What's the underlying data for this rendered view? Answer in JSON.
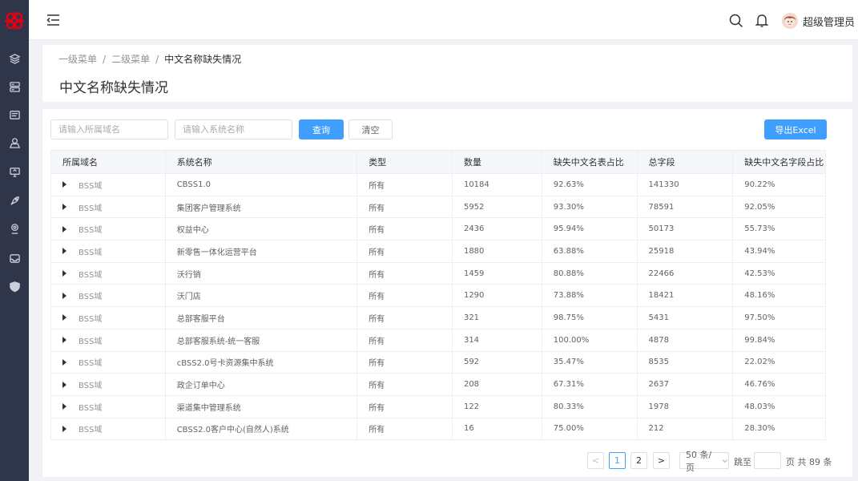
{
  "topbar": {
    "user_name": "超级管理员"
  },
  "breadcrumb": {
    "level1": "一级菜单",
    "level2": "二级菜单",
    "current": "中文名称缺失情况",
    "sep": "/"
  },
  "page": {
    "title": "中文名称缺失情况"
  },
  "filters": {
    "domain_placeholder": "请输入所属域名",
    "system_placeholder": "请输入系统名称",
    "query_label": "查询",
    "clear_label": "清空",
    "export_label": "导出Excel"
  },
  "table": {
    "columns": [
      "所属域名",
      "系统名称",
      "类型",
      "数量",
      "缺失中文名表占比",
      "总字段",
      "缺失中文名字段占比"
    ],
    "rows": [
      [
        "BSS域",
        "CBSS1.0",
        "所有",
        "10184",
        "92.63%",
        "141330",
        "90.22%"
      ],
      [
        "BSS域",
        "集团客户管理系统",
        "所有",
        "5952",
        "93.30%",
        "78591",
        "92.05%"
      ],
      [
        "BSS域",
        "权益中心",
        "所有",
        "2436",
        "95.94%",
        "50173",
        "55.73%"
      ],
      [
        "BSS域",
        "新零售一体化运营平台",
        "所有",
        "1880",
        "63.88%",
        "25918",
        "43.94%"
      ],
      [
        "BSS域",
        "沃行销",
        "所有",
        "1459",
        "80.88%",
        "22466",
        "42.53%"
      ],
      [
        "BSS域",
        "沃门店",
        "所有",
        "1290",
        "73.88%",
        "18421",
        "48.16%"
      ],
      [
        "BSS域",
        "总部客服平台",
        "所有",
        "321",
        "98.75%",
        "5431",
        "97.50%"
      ],
      [
        "BSS域",
        "总部客服系统-统一客服",
        "所有",
        "314",
        "100.00%",
        "4878",
        "99.84%"
      ],
      [
        "BSS域",
        "cBSS2.0号卡资源集中系统",
        "所有",
        "592",
        "35.47%",
        "8535",
        "22.02%"
      ],
      [
        "BSS域",
        "政企订单中心",
        "所有",
        "208",
        "67.31%",
        "2637",
        "46.76%"
      ],
      [
        "BSS域",
        "渠道集中管理系统",
        "所有",
        "122",
        "80.33%",
        "1978",
        "48.03%"
      ],
      [
        "BSS域",
        "CBSS2.0客户中心(自然人)系统",
        "所有",
        "16",
        "75.00%",
        "212",
        "28.30%"
      ]
    ]
  },
  "pagination": {
    "prev": "<",
    "next": ">",
    "pages": [
      "1",
      "2"
    ],
    "page_size": "50 条/页",
    "jump_label": "跳至",
    "jump_unit": "页",
    "total": "共 89 条"
  },
  "colors": {
    "primary": "#409eff",
    "sidebar": "#30364a",
    "logo": "#e60012"
  },
  "icons": {
    "sidebar": [
      "layers-icon",
      "database-icon",
      "document-icon",
      "user-location-icon",
      "monitor-icon",
      "rocket-icon",
      "location-pin-icon",
      "inbox-icon",
      "shield-icon"
    ],
    "topbar": [
      "menu-fold-icon",
      "search-icon",
      "bell-icon",
      "avatar"
    ]
  }
}
